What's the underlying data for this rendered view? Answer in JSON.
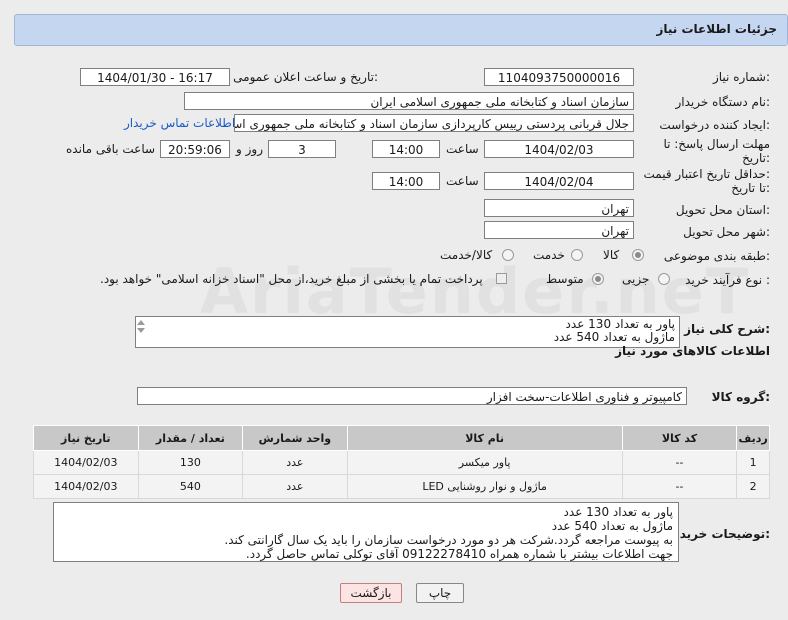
{
  "header": {
    "title": "جزئیات اطلاعات نیاز"
  },
  "watermark": "AriaTender.neT",
  "form": {
    "need_number_label": "شماره نیاز:",
    "need_number": "1104093750000016",
    "announce_label": "تاریخ و ساعت اعلان عمومی:",
    "announce_value": "1404/01/30 - 16:17",
    "buyer_org_label": "نام دستگاه خریدار:",
    "buyer_org": "سازمان اسناد و کتابخانه ملی جمهوری اسلامی ایران",
    "requester_label": "ایجاد کننده درخواست:",
    "requester": "جلال قربانی پردستی رییس کارپردازی سازمان اسناد و کتابخانه ملی جمهوری اسلامی ایران",
    "buyer_contact_link": "اطلاعات تماس خریدار",
    "deadline_label_1": "مهلت ارسال پاسخ: تا",
    "deadline_label_2": "تاریخ:",
    "deadline_date": "1404/02/03",
    "time_label": "ساعت",
    "deadline_time": "14:00",
    "days_value": "3",
    "days_label": "روز و",
    "remaining_time": "20:59:06",
    "remaining_label": "ساعت باقی مانده",
    "price_label_1": "حداقل تاریخ اعتبار قیمت:",
    "price_label_2": "تا تاریخ:",
    "price_date": "1404/02/04",
    "price_time": "14:00",
    "province_label": "استان محل تحویل:",
    "province": "تهران",
    "city_label": "شهر محل تحویل:",
    "city": "تهران",
    "category_label": "طبقه بندی موضوعی:",
    "category_options": [
      "کالا",
      "خدمت",
      "کالا/خدمت"
    ],
    "category_selected": "کالا",
    "process_label": "نوع فرآیند خرید :",
    "process_options": [
      "جزیی",
      "متوسط"
    ],
    "process_selected": "متوسط",
    "payment_note": "پرداخت تمام یا بخشی از مبلغ خرید،از محل \"اسناد خزانه اسلامی\" خواهد بود."
  },
  "summary": {
    "label": "شرح کلی نیاز:",
    "lines": [
      "پاور به تعداد 130 عدد",
      "ماژول به تعداد 540 عدد"
    ]
  },
  "goods": {
    "section_title": "اطلاعات کالاهای مورد نیاز",
    "group_label": "گروه کالا:",
    "group_value": "کامپیوتر و فناوری اطلاعات-سخت افزار",
    "columns": [
      "ردیف",
      "کد کالا",
      "نام کالا",
      "واحد شمارش",
      "تعداد / مقدار",
      "تاریخ نیاز"
    ],
    "rows": [
      {
        "idx": "1",
        "code": "--",
        "name": "پاور میکسر",
        "unit": "عدد",
        "qty": "130",
        "date": "1404/02/03"
      },
      {
        "idx": "2",
        "code": "--",
        "name": "ماژول و نوار روشنایی LED",
        "unit": "عدد",
        "qty": "540",
        "date": "1404/02/03"
      }
    ]
  },
  "buyer_notes": {
    "label": "توضیحات خریدار:",
    "lines": [
      "پاور به تعداد 130 عدد",
      "ماژول به تعداد 540 عدد",
      "به پیوست مراجعه گردد.شرکت هر دو مورد درخواست سازمان را باید یک سال گارانتی کند.",
      "جهت اطلاعات بیشتر با شماره همراه 09122278410 آقای توکلی تماس حاصل گردد."
    ]
  },
  "buttons": {
    "print": "چاپ",
    "back": "بازگشت"
  }
}
